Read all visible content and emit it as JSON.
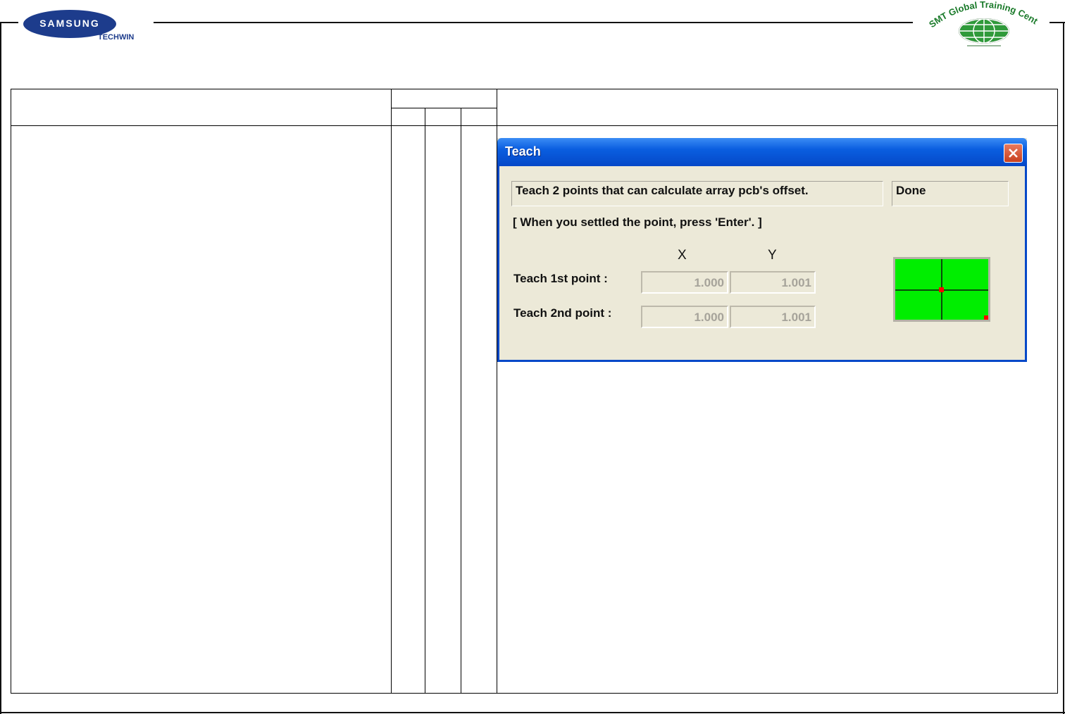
{
  "header": {
    "left_logo": {
      "brand": "SAMSUNG",
      "sub": "TECHWIN"
    },
    "right_logo": {
      "text": "SMT Global Training Center"
    }
  },
  "dialog": {
    "title": "Teach",
    "instruction": "Teach 2 points that can calculate array pcb's offset.",
    "status": "Done",
    "hint": "[ When you settled the point, press 'Enter'. ]",
    "columns": {
      "x": "X",
      "y": "Y"
    },
    "points": [
      {
        "label": "Teach 1st point :",
        "x": "1.000",
        "y": "1.001"
      },
      {
        "label": "Teach 2nd point :",
        "x": "1.000",
        "y": "1.001"
      }
    ],
    "diagram": {
      "fill_color": "#00ee00",
      "marker_color": "#ff0000"
    }
  }
}
